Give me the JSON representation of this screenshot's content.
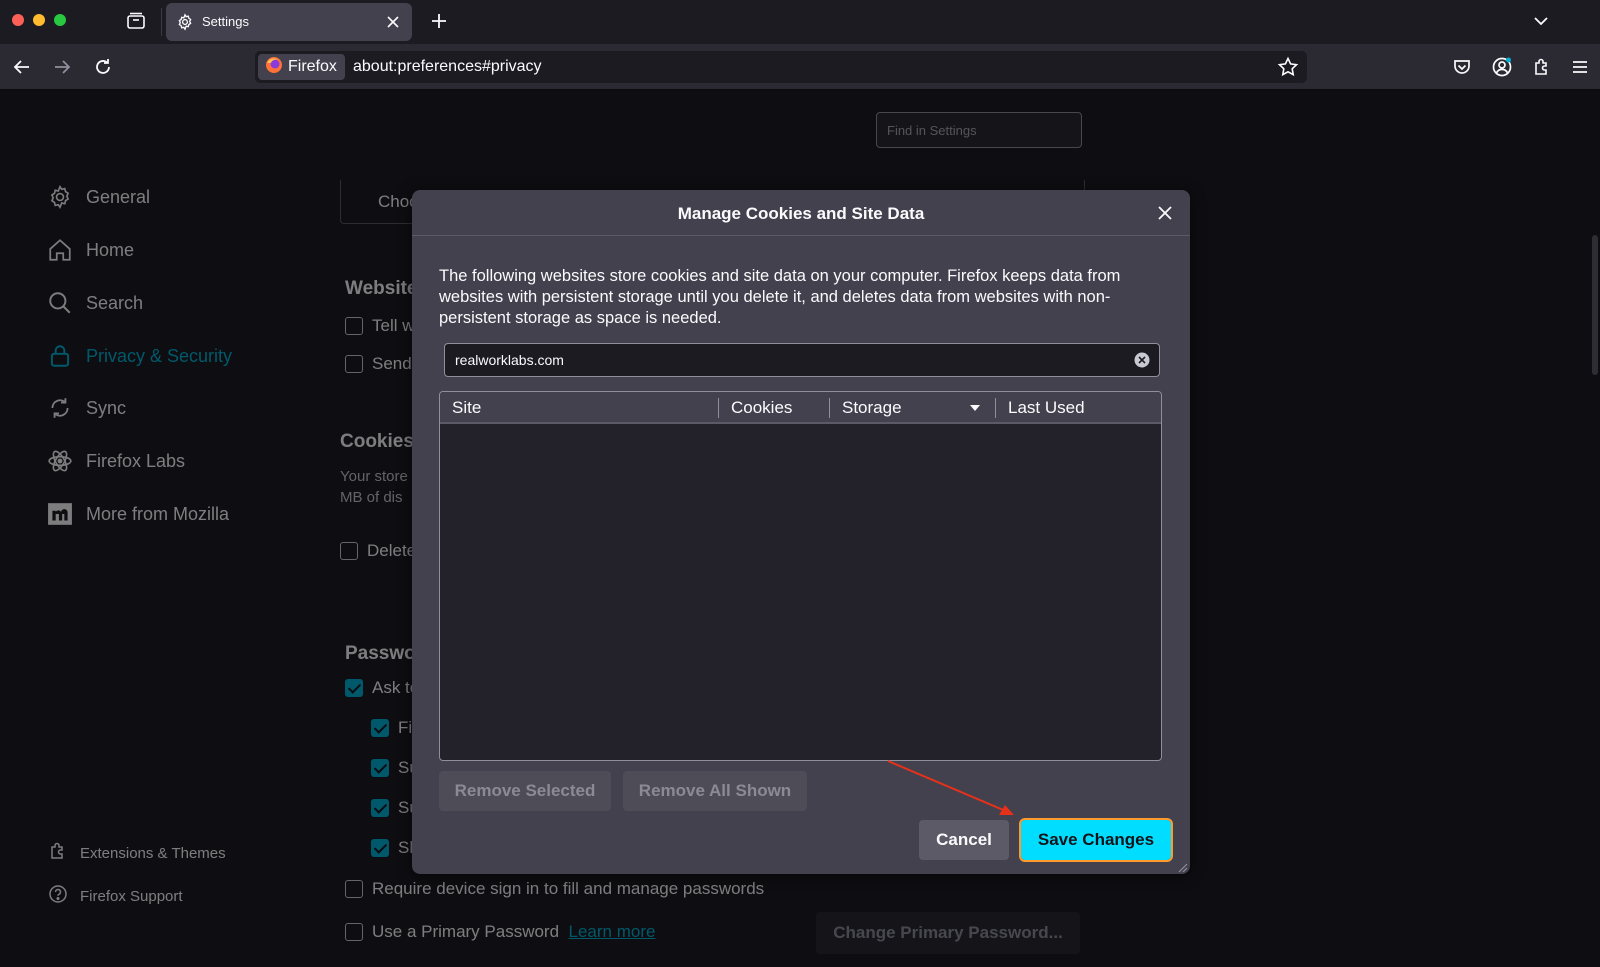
{
  "browser": {
    "tab_title": "Settings",
    "identity_label": "Firefox",
    "url": "about:preferences#privacy"
  },
  "settings": {
    "find_placeholder": "Find in Settings",
    "sidebar": [
      {
        "label": "General"
      },
      {
        "label": "Home"
      },
      {
        "label": "Search"
      },
      {
        "label": "Privacy & Security"
      },
      {
        "label": "Sync"
      },
      {
        "label": "Firefox Labs"
      },
      {
        "label": "More from Mozilla"
      }
    ],
    "sidebar_footer": [
      {
        "label": "Extensions & Themes"
      },
      {
        "label": "Firefox Support"
      }
    ],
    "background": {
      "choose_fragment": "Choo",
      "website_heading": "Website",
      "tell_fragment": "Tell w",
      "send_fragment": "Send",
      "cookies_heading": "Cookies",
      "stored_line1": "Your store",
      "stored_line2": "MB of dis",
      "delete_fragment": "Delete",
      "passwords_heading": "Passwo",
      "ask_fragment": "Ask to",
      "fill_fragment": "Fi",
      "suggest_fragment": "Su",
      "suggest2_fragment": "Su",
      "show_fragment": "Sh",
      "require_label": "Require device sign in to fill and manage passwords",
      "primary_label": "Use a Primary Password",
      "learn_more": "Learn more",
      "change_primary_btn": "Change Primary Password..."
    }
  },
  "dialog": {
    "title": "Manage Cookies and Site Data",
    "description": "The following websites store cookies and site data on your computer. Firefox keeps data from websites with persistent storage until you delete it, and deletes data from websites with non-persistent storage as space is needed.",
    "search_value": "realworklabs.com",
    "columns": [
      "Site",
      "Cookies",
      "Storage",
      "Last Used"
    ],
    "remove_selected": "Remove Selected",
    "remove_all": "Remove All Shown",
    "cancel": "Cancel",
    "save": "Save Changes"
  },
  "colors": {
    "accent": "#00b3d7",
    "primary_button": "#00ddff",
    "focus_outline": "#ff9a2e",
    "annotation_arrow": "#e8311a"
  }
}
